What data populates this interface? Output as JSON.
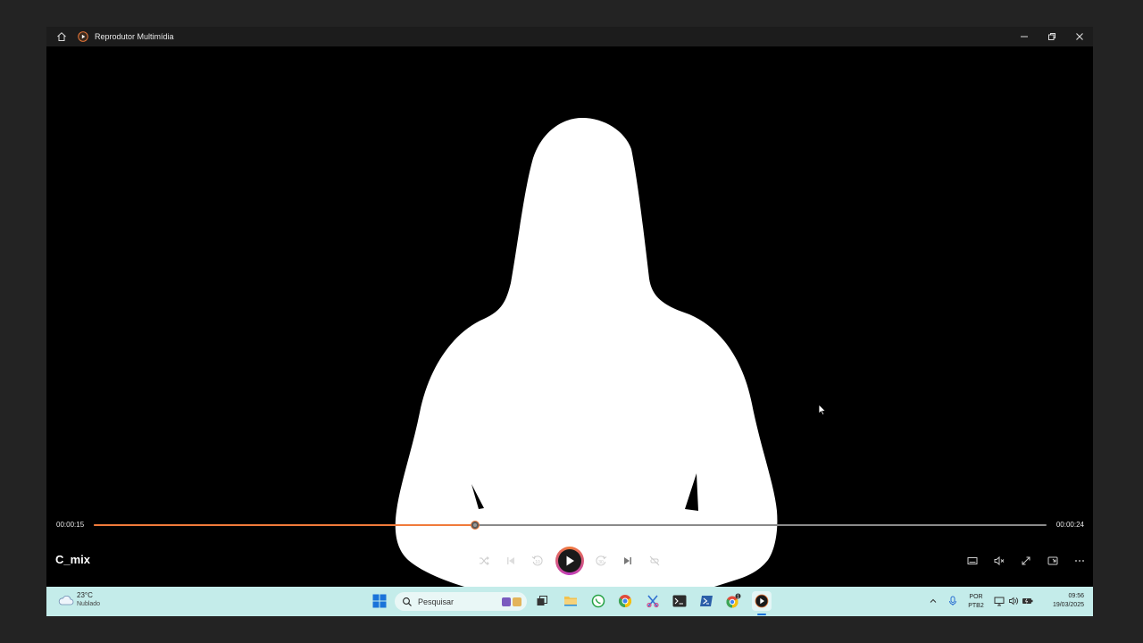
{
  "window": {
    "title": "Reprodutor Multimídia",
    "controls": [
      "minimize",
      "restore",
      "close"
    ]
  },
  "player": {
    "media_title": "C_mix",
    "current_time": "00:00:15",
    "total_time": "00:00:24",
    "progress": 0.4,
    "state": "paused",
    "accent_color": "#f07a3a"
  },
  "taskbar": {
    "weather": {
      "temperature": "23°C",
      "condition": "Nublado"
    },
    "search_placeholder": "Pesquisar",
    "language": {
      "line1": "POR",
      "line2": "PTB2"
    },
    "clock": {
      "time": "09:56",
      "date": "19/03/2025"
    },
    "chrome_badge": "1"
  }
}
